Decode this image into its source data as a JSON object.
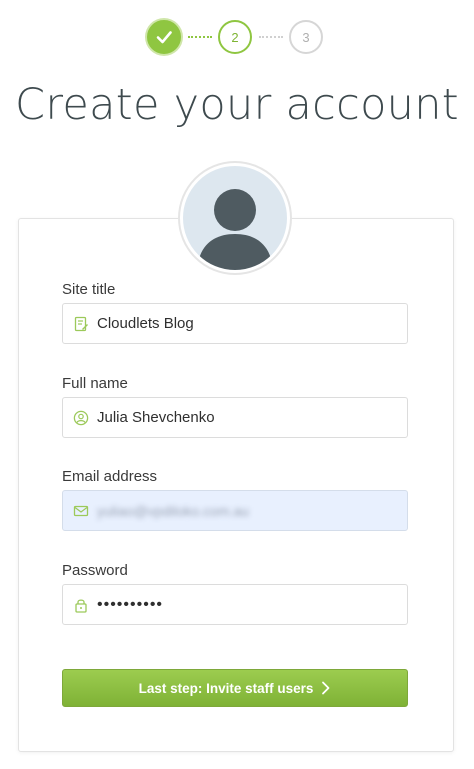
{
  "steps": [
    {
      "label": "",
      "state": "done"
    },
    {
      "label": "2",
      "state": "current"
    },
    {
      "label": "3",
      "state": "future"
    }
  ],
  "page_title": "Create your account",
  "form": {
    "site_title": {
      "label": "Site title",
      "value": "Cloudlets Blog",
      "icon": "document-edit-icon"
    },
    "full_name": {
      "label": "Full name",
      "value": "Julia Shevchenko",
      "icon": "user-circle-icon"
    },
    "email": {
      "label": "Email address",
      "value": "yuliao@vpdiloko.com.au",
      "icon": "envelope-icon"
    },
    "password": {
      "label": "Password",
      "value": "••••••••••",
      "icon": "lock-icon"
    }
  },
  "submit_label": "Last step: Invite staff users",
  "colors": {
    "accent": "#8fc641",
    "button_top": "#9ccc4f",
    "button_bottom": "#7fb236",
    "autofill": "#e8f0fe"
  }
}
